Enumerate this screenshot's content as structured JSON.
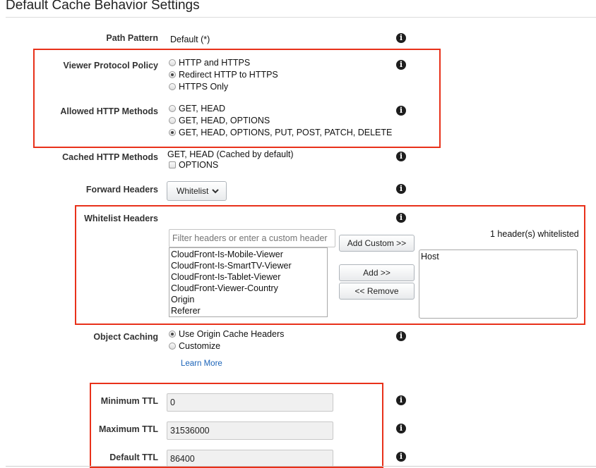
{
  "page_title": "Default Cache Behavior Settings",
  "path_pattern": {
    "label": "Path Pattern",
    "value": "Default (*)"
  },
  "viewer_protocol_policy": {
    "label": "Viewer Protocol Policy",
    "options": [
      "HTTP and HTTPS",
      "Redirect HTTP to HTTPS",
      "HTTPS Only"
    ],
    "selected": "Redirect HTTP to HTTPS"
  },
  "allowed_http_methods": {
    "label": "Allowed HTTP Methods",
    "options": [
      "GET, HEAD",
      "GET, HEAD, OPTIONS",
      "GET, HEAD, OPTIONS, PUT, POST, PATCH, DELETE"
    ],
    "selected": "GET, HEAD, OPTIONS, PUT, POST, PATCH, DELETE"
  },
  "cached_http_methods": {
    "label": "Cached HTTP Methods",
    "value": "GET, HEAD (Cached by default)",
    "checkbox_label": "OPTIONS",
    "checked": false
  },
  "forward_headers": {
    "label": "Forward Headers",
    "selected": "Whitelist"
  },
  "whitelist_headers": {
    "label": "Whitelist Headers",
    "filter_placeholder": "Filter headers or enter a custom header",
    "available": [
      "CloudFront-Is-Mobile-Viewer",
      "CloudFront-Is-SmartTV-Viewer",
      "CloudFront-Is-Tablet-Viewer",
      "CloudFront-Viewer-Country",
      "Origin",
      "Referer"
    ],
    "add_custom_label": "Add Custom >>",
    "add_label": "Add >>",
    "remove_label": "<< Remove",
    "count_text": "1 header(s) whitelisted",
    "whitelisted": [
      "Host"
    ]
  },
  "object_caching": {
    "label": "Object Caching",
    "options": [
      "Use Origin Cache Headers",
      "Customize"
    ],
    "selected": "Use Origin Cache Headers",
    "learn_more": "Learn More"
  },
  "ttl": {
    "minimum": {
      "label": "Minimum TTL",
      "value": "0"
    },
    "maximum": {
      "label": "Maximum TTL",
      "value": "31536000"
    },
    "default": {
      "label": "Default TTL",
      "value": "86400"
    }
  },
  "colors": {
    "highlight": "#e8311a",
    "link": "#1a63b8",
    "info_icon": "#1e1e1e"
  }
}
